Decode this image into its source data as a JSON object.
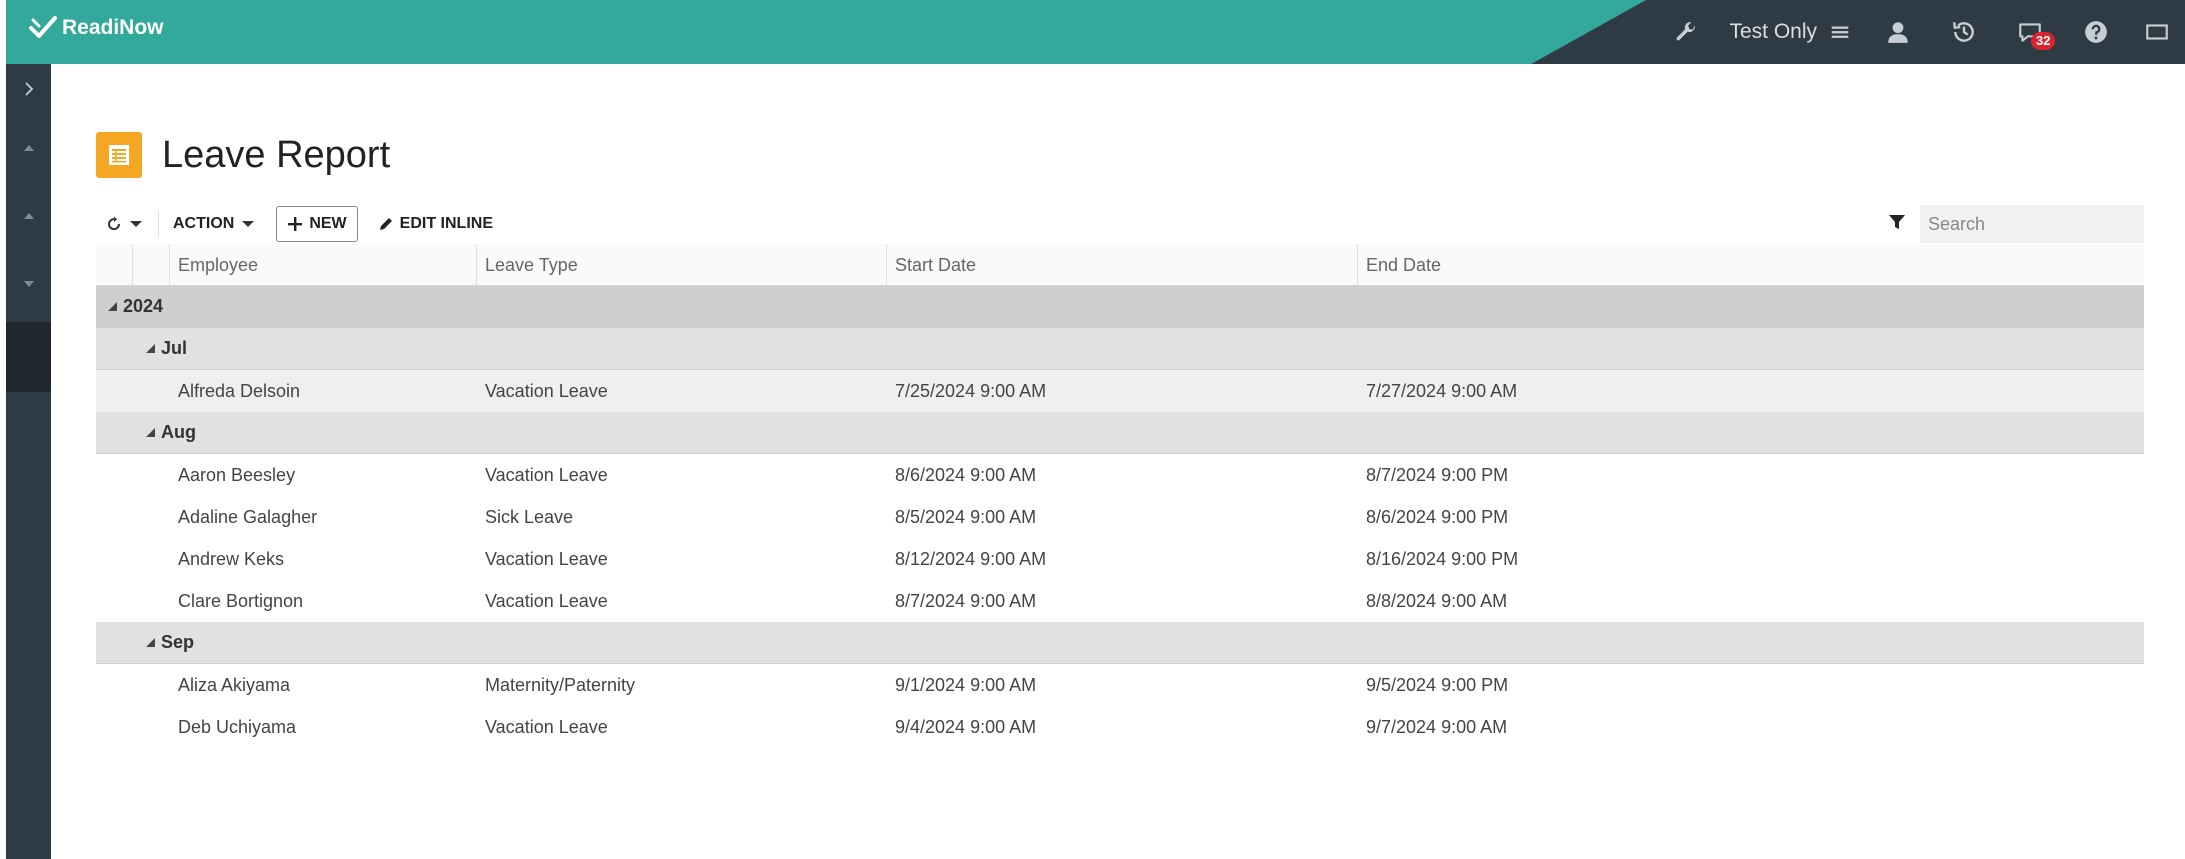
{
  "app": {
    "logo_text": "ReadiNow",
    "app_label": "Test Only",
    "notification_count": "32"
  },
  "page": {
    "title": "Leave Report"
  },
  "toolbar": {
    "action_label": "ACTION",
    "new_label": "NEW",
    "edit_inline_label": "EDIT INLINE",
    "search_placeholder": "Search"
  },
  "columns": [
    "Employee",
    "Leave Type",
    "Start Date",
    "End Date"
  ],
  "groups": [
    {
      "year": "2024"
    }
  ],
  "months": {
    "jul": "Jul",
    "aug": "Aug",
    "sep": "Sep"
  },
  "rows": [
    {
      "employee": "Alfreda Delsoin",
      "leave_type": "Vacation Leave",
      "start": "7/25/2024 9:00 AM",
      "end": "7/27/2024 9:00 AM"
    },
    {
      "employee": "Aaron Beesley",
      "leave_type": "Vacation Leave",
      "start": "8/6/2024 9:00 AM",
      "end": "8/7/2024 9:00 PM"
    },
    {
      "employee": "Adaline Galagher",
      "leave_type": "Sick Leave",
      "start": "8/5/2024 9:00 AM",
      "end": "8/6/2024 9:00 PM"
    },
    {
      "employee": "Andrew Keks",
      "leave_type": "Vacation Leave",
      "start": "8/12/2024 9:00 AM",
      "end": "8/16/2024 9:00 PM"
    },
    {
      "employee": "Clare Bortignon",
      "leave_type": "Vacation Leave",
      "start": "8/7/2024 9:00 AM",
      "end": "8/8/2024 9:00 AM"
    },
    {
      "employee": "Aliza Akiyama",
      "leave_type": "Maternity/Paternity",
      "start": "9/1/2024 9:00 AM",
      "end": "9/5/2024 9:00 PM"
    },
    {
      "employee": "Deb Uchiyama",
      "leave_type": "Vacation Leave",
      "start": "9/4/2024 9:00 AM",
      "end": "9/7/2024 9:00 AM"
    }
  ],
  "colors": {
    "brand_teal": "#33a99c",
    "header_dark": "#2e3b45",
    "report_icon": "#f5a623",
    "badge_red": "#d9232e"
  }
}
